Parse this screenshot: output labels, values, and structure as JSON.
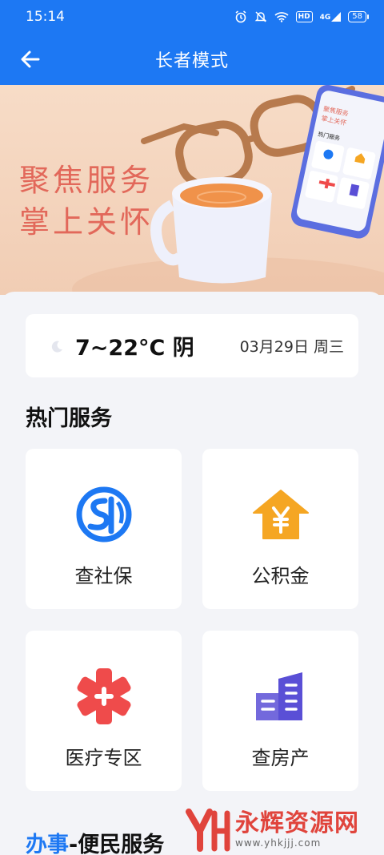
{
  "status_bar": {
    "time": "15:14",
    "hd": "HD",
    "signal": "4G",
    "battery": "58"
  },
  "nav": {
    "title": "长者模式"
  },
  "banner": {
    "line1": "聚焦服务",
    "line2": "掌上关怀",
    "phone_heading": "热门服务"
  },
  "weather": {
    "temp_condition": "7~22°C 阴",
    "date": "03月29日 周三"
  },
  "hot_services": {
    "title": "热门服务",
    "items": [
      {
        "label": "查社保",
        "icon": "social-security-icon",
        "color": "#1d78f3"
      },
      {
        "label": "公积金",
        "icon": "housing-fund-icon",
        "color": "#f5a623"
      },
      {
        "label": "医疗专区",
        "icon": "medical-cross-icon",
        "color": "#ef4b4b"
      },
      {
        "label": "查房产",
        "icon": "building-icon",
        "color": "#5a4fd6"
      }
    ]
  },
  "bottom_section": {
    "accent": "办事",
    "rest": "-便民服务"
  },
  "watermark": {
    "name": "永辉资源网",
    "url": "www.yhkjjj.com"
  },
  "colors": {
    "brand": "#1d78f3",
    "background": "#f3f4f8"
  }
}
